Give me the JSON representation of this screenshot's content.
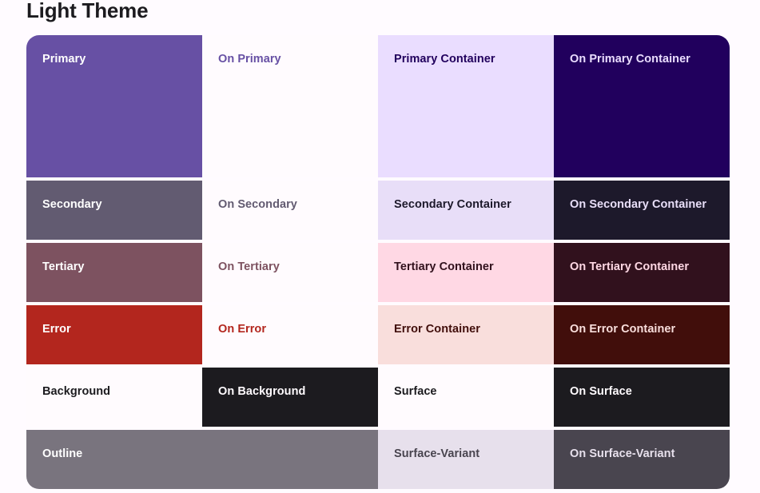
{
  "page": {
    "title": "Light Theme",
    "background_color": "#FFFBFF",
    "title_color": "#1C1B1F"
  },
  "palette": {
    "rows": [
      {
        "name": "primary-row",
        "cells": [
          {
            "label": "Primary",
            "bg": "#6750A4",
            "fg": "#FFFFFF"
          },
          {
            "label": "On Primary",
            "bg": "#FFFBFE",
            "fg": "#6750A4"
          },
          {
            "label": "Primary Container",
            "bg": "#EADDFF",
            "fg": "#21005D"
          },
          {
            "label": "On Primary Container",
            "bg": "#21005D",
            "fg": "#EADDFF"
          }
        ]
      },
      {
        "name": "secondary-row",
        "cells": [
          {
            "label": "Secondary",
            "bg": "#625B71",
            "fg": "#FFFFFF"
          },
          {
            "label": "On Secondary",
            "bg": "#FFFBFE",
            "fg": "#625B71"
          },
          {
            "label": "Secondary Container",
            "bg": "#E8DEF8",
            "fg": "#1D192B"
          },
          {
            "label": "On Secondary Container",
            "bg": "#1D192B",
            "fg": "#E8DEF8"
          }
        ]
      },
      {
        "name": "tertiary-row",
        "cells": [
          {
            "label": "Tertiary",
            "bg": "#7D5260",
            "fg": "#FFFFFF"
          },
          {
            "label": "On Tertiary",
            "bg": "#FFFBFE",
            "fg": "#7D5260"
          },
          {
            "label": "Tertiary Container",
            "bg": "#FFD8E4",
            "fg": "#31111D"
          },
          {
            "label": "On Tertiary Container",
            "bg": "#31111D",
            "fg": "#FFD8E4"
          }
        ]
      },
      {
        "name": "error-row",
        "cells": [
          {
            "label": "Error",
            "bg": "#B3261E",
            "fg": "#FFFFFF"
          },
          {
            "label": "On Error",
            "bg": "#FFFBFE",
            "fg": "#B3261E"
          },
          {
            "label": "Error Container",
            "bg": "#F9DEDC",
            "fg": "#410E0B"
          },
          {
            "label": "On Error Container",
            "bg": "#410E0B",
            "fg": "#F9DEDC"
          }
        ]
      },
      {
        "name": "background-surface-row",
        "cells": [
          {
            "label": "Background",
            "bg": "#FFFBFE",
            "fg": "#1C1B1F"
          },
          {
            "label": "On Background",
            "bg": "#1C1B1F",
            "fg": "#FFFBFE"
          },
          {
            "label": "Surface",
            "bg": "#FFFBFE",
            "fg": "#1C1B1F"
          },
          {
            "label": "On Surface",
            "bg": "#1C1B1F",
            "fg": "#FFFBFE"
          }
        ]
      },
      {
        "name": "outline-variant-row",
        "cells": [
          {
            "label": "Outline",
            "bg": "#79747E",
            "fg": "#FFFFFF"
          },
          {
            "label": "Surface-Variant",
            "bg": "#E7E0EC",
            "fg": "#49454F"
          },
          {
            "label": "On Surface-Variant",
            "bg": "#49454F",
            "fg": "#E7E0EC"
          }
        ]
      }
    ]
  }
}
